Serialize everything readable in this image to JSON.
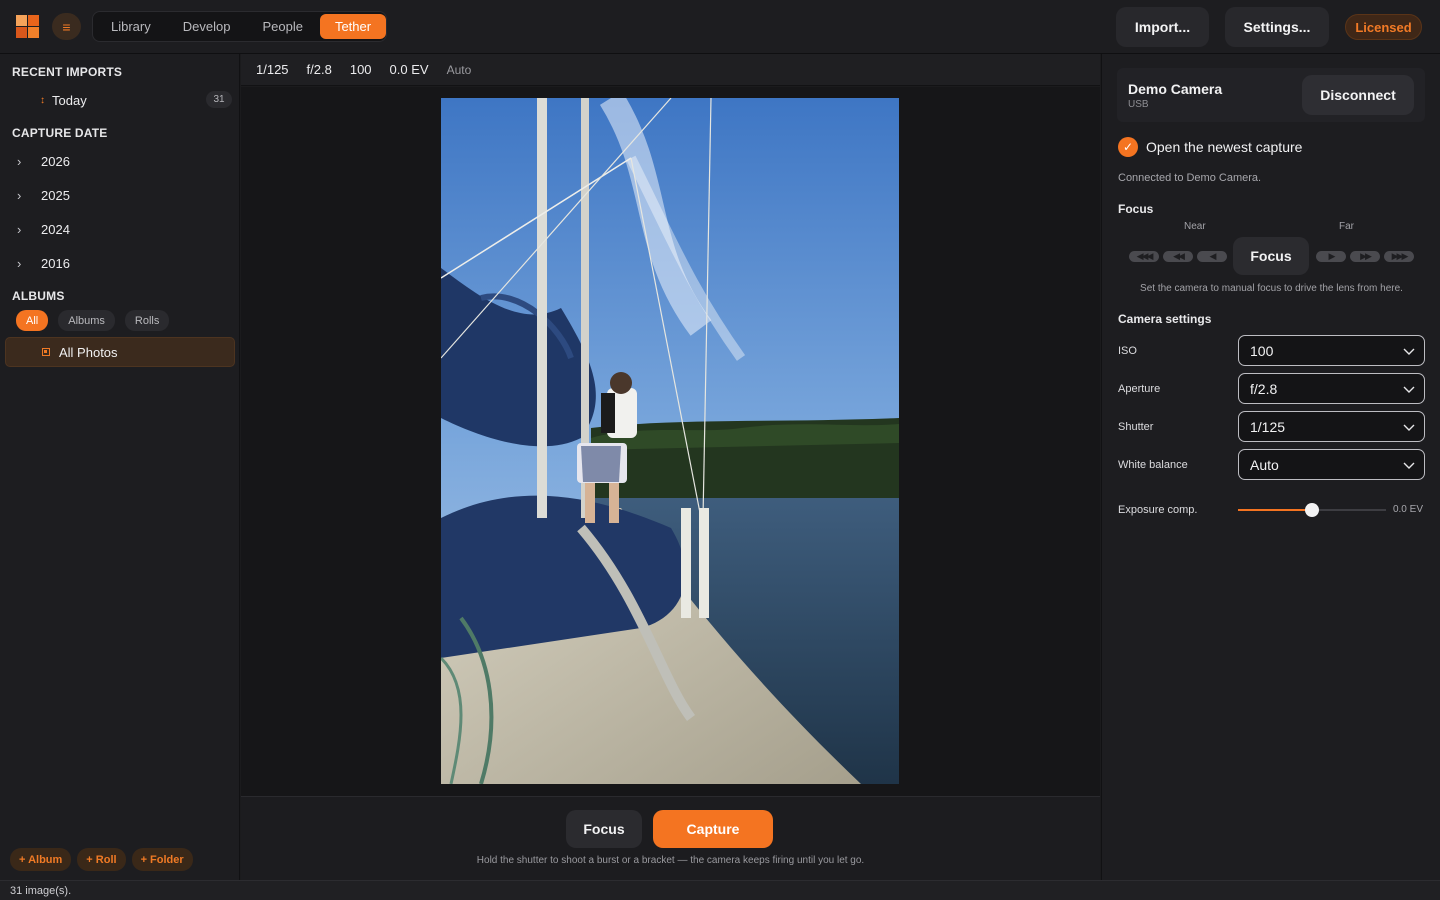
{
  "colors": {
    "accent": "#f47421",
    "bg": "#1b1b1d",
    "panel": "#1d1d20"
  },
  "topbar": {
    "menu_icon": "hamburger-icon",
    "modes": [
      "Library",
      "Develop",
      "People",
      "Tether"
    ],
    "active_mode": "Tether",
    "import_label": "Import...",
    "settings_label": "Settings...",
    "licensed_label": "Licensed"
  },
  "sidebar": {
    "recent_title": "RECENT IMPORTS",
    "recent": {
      "label": "Today",
      "count": "31"
    },
    "capture_title": "CAPTURE DATE",
    "years": [
      "2026",
      "2025",
      "2024",
      "2016"
    ],
    "albums_title": "ALBUMS",
    "album_filters": [
      "All",
      "Albums",
      "Rolls"
    ],
    "active_filter": "All",
    "all_photos": "All Photos",
    "add_buttons": [
      "+ Album",
      "+ Roll",
      "+ Folder"
    ]
  },
  "infobar": {
    "shutter": "1/125",
    "aperture": "f/2.8",
    "iso": "100",
    "ev": "0.0 EV",
    "wb": "Auto"
  },
  "bottom": {
    "focus_label": "Focus",
    "capture_label": "Capture",
    "hint": "Hold the shutter to shoot a burst or a bracket — the camera keeps firing until you let go."
  },
  "right": {
    "camera_name": "Demo Camera",
    "camera_conn": "USB",
    "disconnect_label": "Disconnect",
    "open_newest": "Open the newest capture",
    "open_newest_checked": true,
    "connected_text": "Connected to Demo Camera.",
    "focus_title": "Focus",
    "near_label": "Near",
    "far_label": "Far",
    "focus_button": "Focus",
    "focus_hint": "Set the camera to manual focus to drive the lens from here.",
    "settings_title": "Camera settings",
    "settings": [
      {
        "label": "ISO",
        "value": "100"
      },
      {
        "label": "Aperture",
        "value": "f/2.8"
      },
      {
        "label": "Shutter",
        "value": "1/125"
      },
      {
        "label": "White balance",
        "value": "Auto"
      }
    ],
    "exposure_label": "Exposure comp.",
    "exposure_value": "0.0 EV",
    "exposure_fraction": 0.5
  },
  "status": {
    "text": "31 image(s)."
  }
}
